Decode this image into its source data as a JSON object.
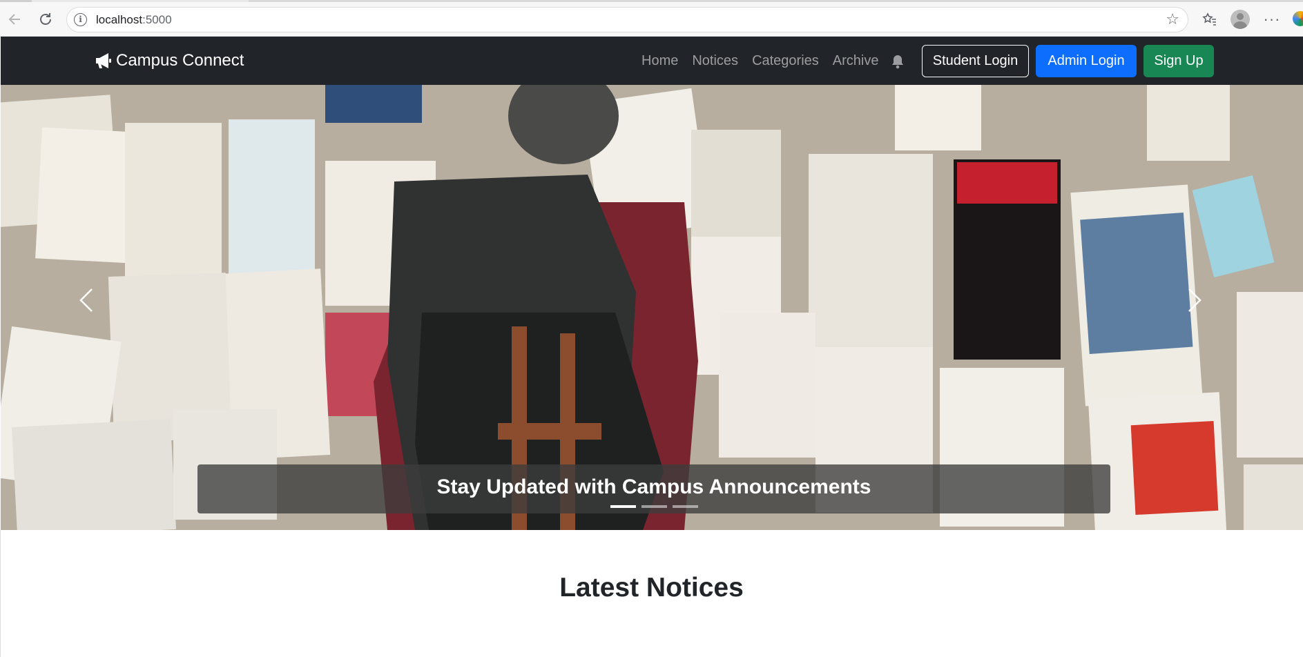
{
  "browser": {
    "url_host": "localhost",
    "url_port": ":5000"
  },
  "navbar": {
    "brand": "Campus Connect",
    "links": [
      {
        "label": "Home"
      },
      {
        "label": "Notices"
      },
      {
        "label": "Categories"
      },
      {
        "label": "Archive"
      }
    ],
    "buttons": {
      "student_login": "Student Login",
      "admin_login": "Admin Login",
      "sign_up": "Sign Up"
    },
    "colors": {
      "background": "#212529",
      "admin_button": "#0d6efd",
      "signup_button": "#198754"
    }
  },
  "carousel": {
    "caption": "Stay Updated with Campus Announcements",
    "slide_count": 3,
    "active_slide": 1,
    "image_description_icon": "bulletin-board-photo"
  },
  "main": {
    "section_title": "Latest Notices"
  }
}
